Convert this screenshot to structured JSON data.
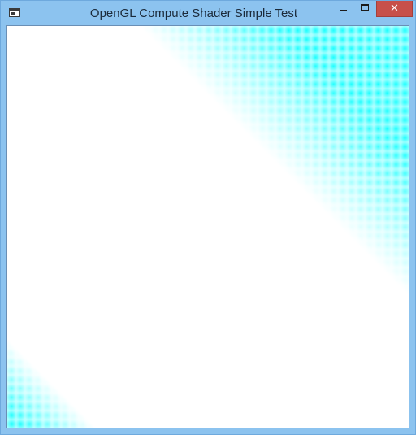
{
  "window": {
    "title": "OpenGL Compute Shader Simple Test",
    "icons": {
      "app": "window-app-icon",
      "minimize": "minimize-icon",
      "maximize": "maximize-icon",
      "close": "close-icon"
    },
    "close_glyph": "✕"
  },
  "render": {
    "background": "#ffffff",
    "dot_color": "#00ffff",
    "pattern": "grid of soft glowing cyan dots, fading toward the white diagonal band"
  }
}
